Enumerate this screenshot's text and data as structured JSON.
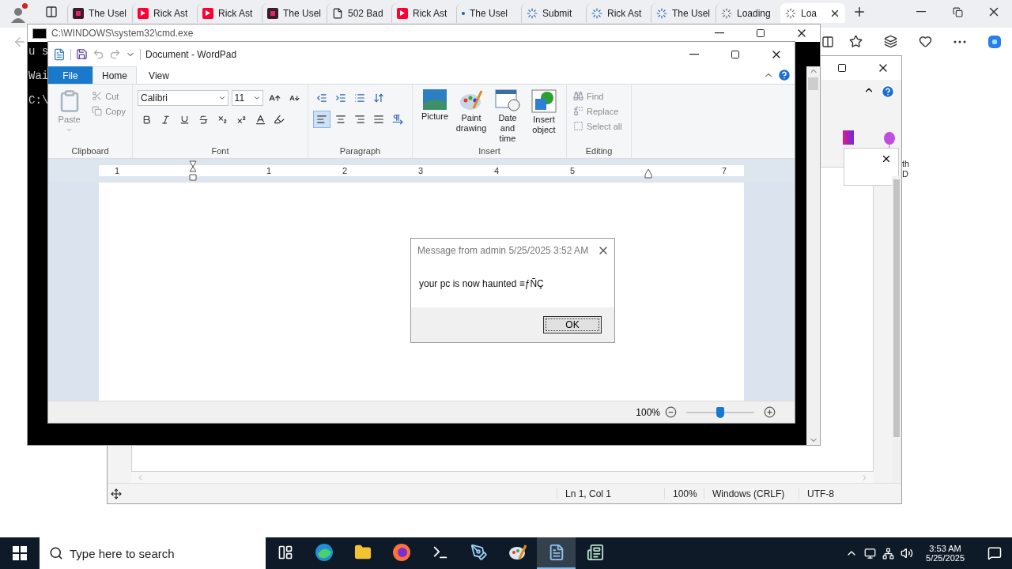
{
  "browser": {
    "tabs": [
      {
        "kind": "app",
        "label": "The Usel",
        "selected": false
      },
      {
        "kind": "video",
        "label": "Rick Ast",
        "selected": false
      },
      {
        "kind": "video",
        "label": "Rick Ast",
        "selected": false
      },
      {
        "kind": "app",
        "label": "The Usel",
        "selected": false
      },
      {
        "kind": "page",
        "label": "502 Bad",
        "selected": false
      },
      {
        "kind": "video",
        "label": "Rick Ast",
        "selected": false
      },
      {
        "kind": "dot",
        "label": "The Usel",
        "selected": false
      },
      {
        "kind": "spinner",
        "label": "Submit",
        "selected": false
      },
      {
        "kind": "spinner",
        "label": "Rick Ast",
        "selected": false
      },
      {
        "kind": "spinner",
        "label": "The Usel",
        "selected": false
      },
      {
        "kind": "loading",
        "label": "Loading",
        "selected": false
      },
      {
        "kind": "loading",
        "label": "Loa",
        "selected": true
      }
    ]
  },
  "notepad": {
    "fragments": [
      "th",
      "D"
    ],
    "status": [
      "Ln 1, Col 1",
      "100%",
      "Windows (CRLF)",
      "UTF-8"
    ]
  },
  "cmd": {
    "title": "C:\\WINDOWS\\system32\\cmd.exe",
    "lines": [
      "u s",
      "Wai",
      "C:\\"
    ]
  },
  "wordpad": {
    "title": "Document - WordPad",
    "tabs": [
      {
        "kind": "file",
        "label": "File",
        "selected": false
      },
      {
        "kind": "tab",
        "label": "Home",
        "selected": true
      },
      {
        "kind": "tab",
        "label": "View",
        "selected": false
      }
    ],
    "clipboard": {
      "label": "Clipboard",
      "paste": "Paste",
      "cut": "Cut",
      "copy": "Copy",
      "disabled": true
    },
    "font": {
      "label": "Font",
      "family": "Calibri",
      "size": "11"
    },
    "paragraph": {
      "label": "Paragraph",
      "align": [
        {
          "kind": "left",
          "selected": true
        },
        {
          "kind": "center",
          "selected": false
        },
        {
          "kind": "right",
          "selected": false
        },
        {
          "kind": "justify",
          "selected": false
        }
      ]
    },
    "insert": {
      "label": "Insert",
      "items": [
        {
          "kind": "picture",
          "label": "Picture"
        },
        {
          "kind": "paint",
          "label": "Paint drawing"
        },
        {
          "kind": "datetime",
          "label": "Date and time"
        },
        {
          "kind": "object",
          "label": "Insert object"
        }
      ]
    },
    "editing": {
      "label": "Editing",
      "disabled": true,
      "items": [
        {
          "kind": "find",
          "label": "Find"
        },
        {
          "kind": "replace",
          "label": "Replace"
        },
        {
          "kind": "select",
          "label": "Select all"
        }
      ]
    },
    "ruler": [
      "1",
      "1",
      "2",
      "3",
      "4",
      "5",
      "7"
    ],
    "zoom": {
      "reading": "100%",
      "level": 0.5
    }
  },
  "dialog": {
    "title": "Message from admin 5/25/2025 3:52 AM",
    "message": "your pc is now haunted ≡ƒÑÇ",
    "button": "OK"
  },
  "taskbar": {
    "search": {
      "placeholder": "Type here to search"
    },
    "apps": [
      {
        "kind": "taskview",
        "selected": false
      },
      {
        "kind": "edge",
        "selected": false
      },
      {
        "kind": "folder",
        "selected": false
      },
      {
        "kind": "firefox",
        "selected": false
      },
      {
        "kind": "terminal",
        "selected": false
      },
      {
        "kind": "notepad",
        "selected": false
      },
      {
        "kind": "paint",
        "selected": false
      },
      {
        "kind": "wordpad",
        "selected": true
      },
      {
        "kind": "app",
        "selected": false
      }
    ],
    "time": "3:53 AM",
    "date": "5/25/2025"
  }
}
